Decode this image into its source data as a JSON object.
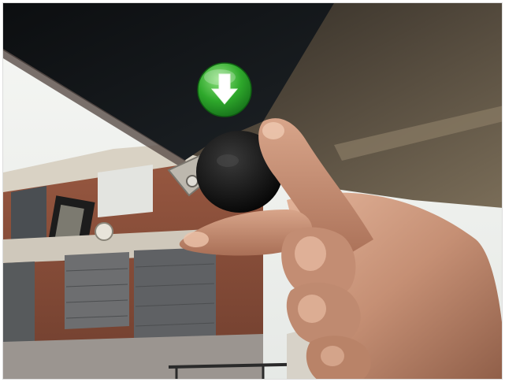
{
  "scene": {
    "subject": "hand-holding-round-sensor",
    "colors": {
      "ceiling_dark": "#14171a",
      "roof_fabric": "#5e5648",
      "sky": "#eef0ee",
      "brick": "#8a4e3a",
      "skin": "#c8957a",
      "sensor": "#141414",
      "bracket": "#b8b4ac"
    }
  },
  "overlay": {
    "icon": "download-arrow-icon",
    "colors": {
      "circle": "#2ea82b",
      "arrow": "#ffffff"
    }
  }
}
